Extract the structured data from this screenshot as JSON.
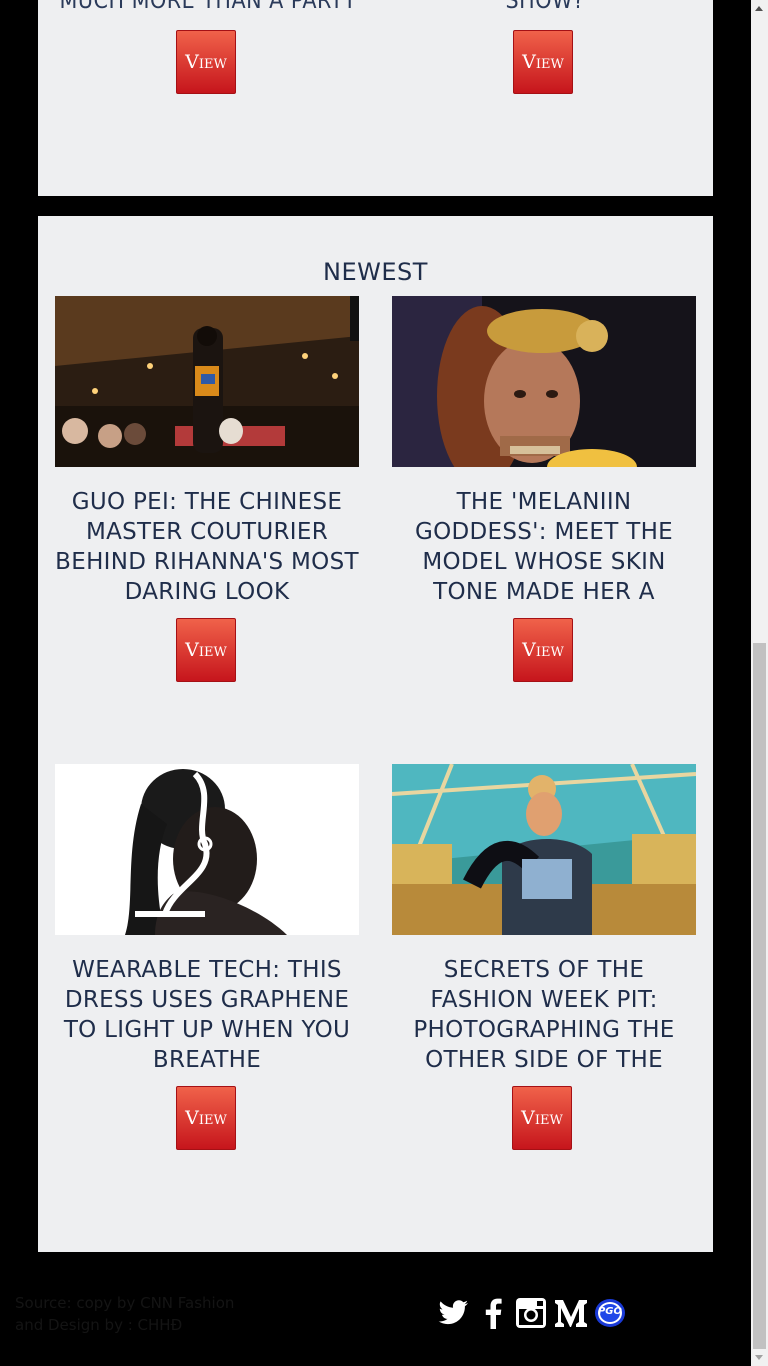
{
  "top": {
    "cut_titles": [
      "MUCH MORE THAN A PARTY",
      "SHOW?"
    ],
    "view_label": "View"
  },
  "newest": {
    "title": "NEWEST",
    "cards": [
      {
        "title": "GUO PEI: THE CHINESE MASTER COUTURIER BEHIND RIHANNA'S MOST DARING LOOK",
        "button": "View"
      },
      {
        "title": "THE 'MELANIIN GODDESS': MEET THE MODEL WHOSE SKIN TONE MADE HER A SOCIAL MEDIA SENSATION",
        "button": "View"
      },
      {
        "title": "WEARABLE TECH: THIS DRESS USES GRAPHENE TO LIGHT UP WHEN YOU BREATHE",
        "button": "View"
      },
      {
        "title": "SECRETS OF THE FASHION WEEK PIT: PHOTOGRAPHING THE OTHER SIDE OF THE RUNWAY",
        "button": "View"
      }
    ]
  },
  "footer": {
    "source_text": "Source: copy by CNN Fashion and Design by : CHHĐ",
    "social": [
      "twitter-icon",
      "facebook-icon",
      "instagram-icon",
      "medium-icon",
      "pgo-icon"
    ],
    "pgo_label": "PGO"
  },
  "colors": {
    "panel_bg": "#eeeff1",
    "page_bg": "#000000",
    "title_color": "#1f2d4a",
    "button_top": "#f0624a",
    "button_bottom": "#c6151c"
  }
}
